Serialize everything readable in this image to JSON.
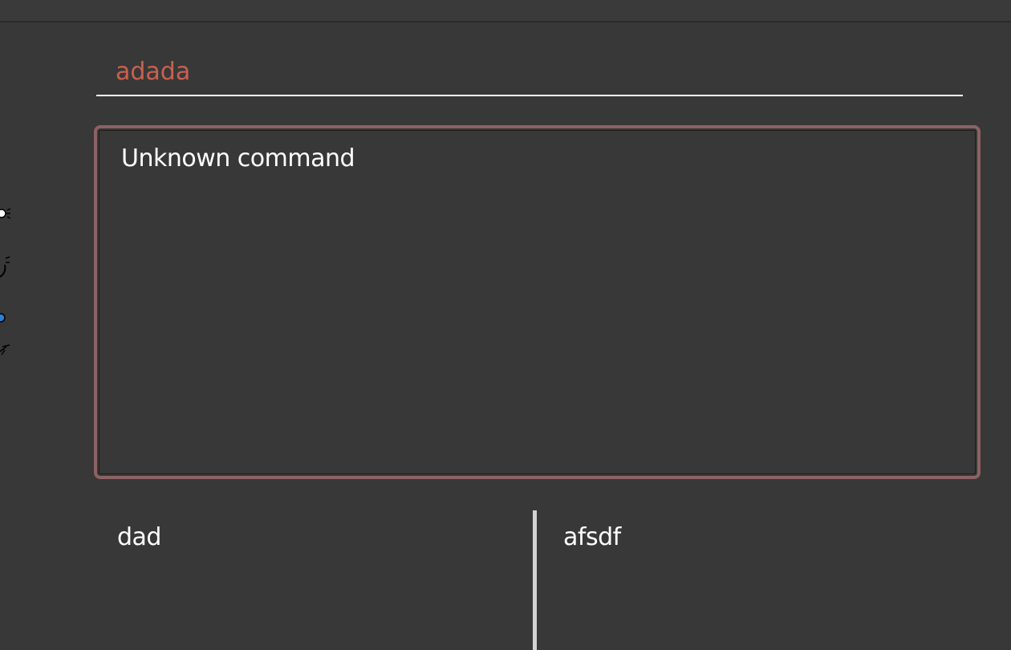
{
  "command_box": {
    "value": "adada"
  },
  "result_display": {
    "text": "Unknown command"
  },
  "panels": {
    "left": {
      "text": "dad"
    },
    "right": {
      "text": "afsdf"
    }
  },
  "colors": {
    "background": "#383838",
    "command_text": "#c9604f",
    "result_border_error": "#8c6262",
    "text": "#ffffff",
    "divider": "#d2d2d2"
  },
  "icons": [
    "sun-icon",
    "sparkle-icon",
    "blue-dot-icon",
    "spark-icon"
  ]
}
